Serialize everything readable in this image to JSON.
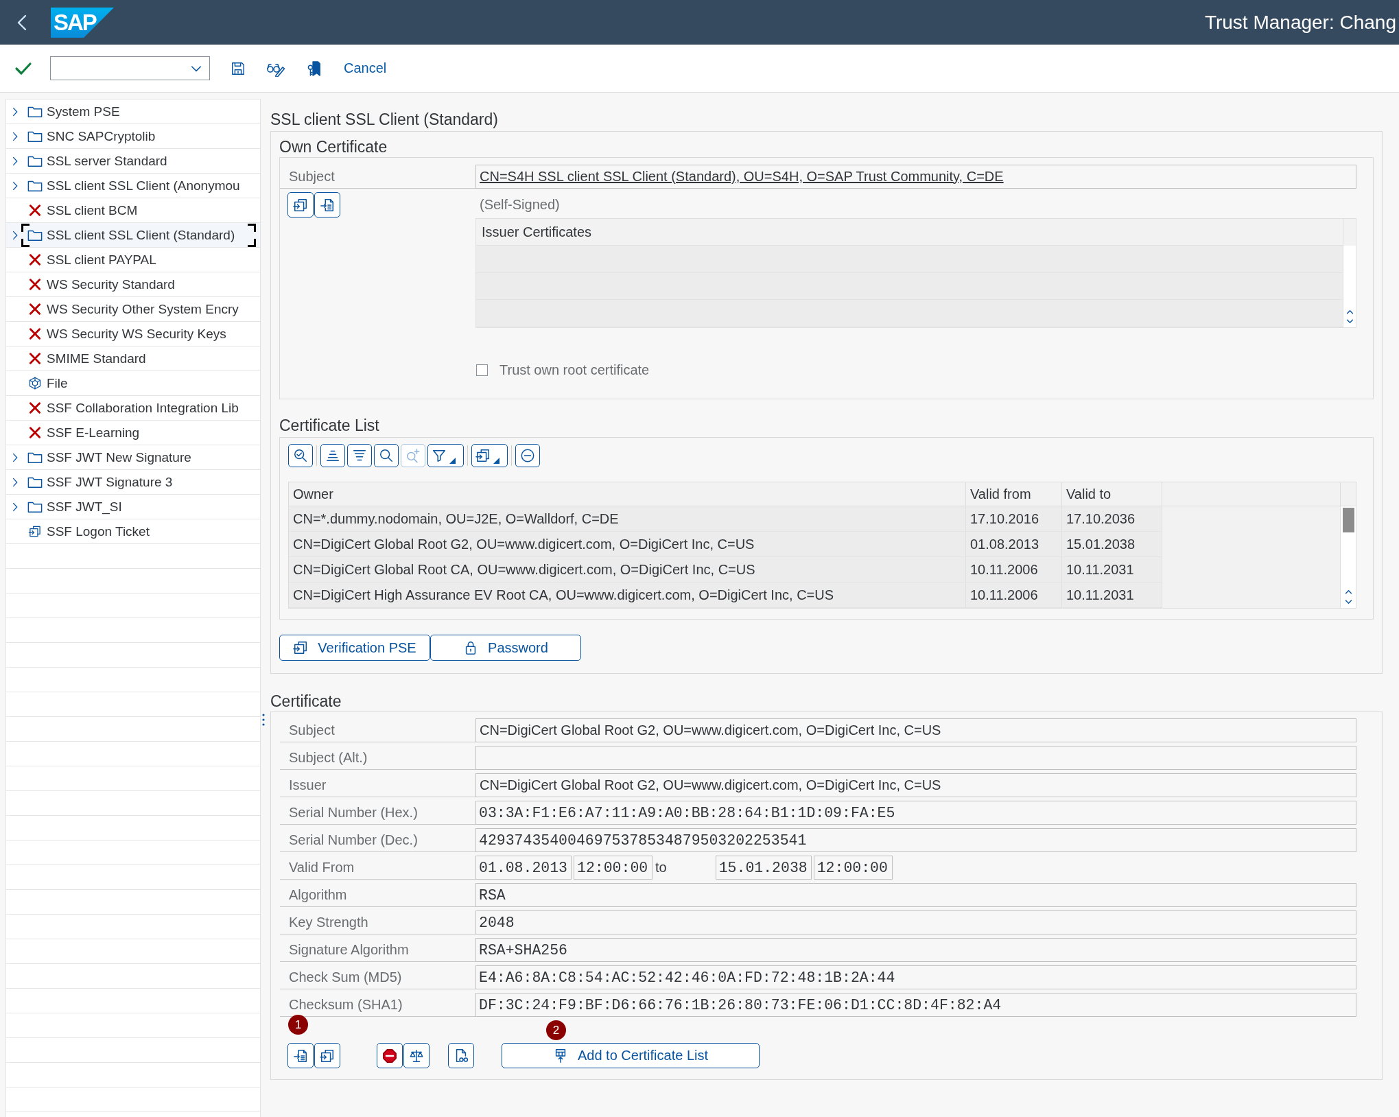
{
  "header": {
    "logo": "SAP",
    "title": "Trust Manager: Chang"
  },
  "toolbar": {
    "cancel": "Cancel"
  },
  "tree": {
    "items": [
      {
        "label": "System PSE",
        "kind": "folder",
        "expanded": false,
        "selected": false
      },
      {
        "label": "SNC SAPCryptolib",
        "kind": "folder",
        "expanded": false,
        "selected": false
      },
      {
        "label": "SSL server Standard",
        "kind": "folder",
        "expanded": false,
        "selected": false
      },
      {
        "label": "SSL client SSL Client (Anonymou",
        "kind": "folder",
        "expanded": false,
        "selected": false
      },
      {
        "label": "SSL client BCM",
        "kind": "error",
        "selected": false
      },
      {
        "label": "SSL client SSL Client (Standard)",
        "kind": "folder",
        "expanded": false,
        "selected": true
      },
      {
        "label": "SSL client PAYPAL",
        "kind": "error",
        "selected": false
      },
      {
        "label": "WS Security Standard",
        "kind": "error",
        "selected": false
      },
      {
        "label": "WS Security Other System Encry",
        "kind": "error",
        "selected": false
      },
      {
        "label": "WS Security WS Security Keys",
        "kind": "error",
        "selected": false
      },
      {
        "label": "SMIME Standard",
        "kind": "error",
        "selected": false
      },
      {
        "label": "File",
        "kind": "file",
        "selected": false
      },
      {
        "label": "SSF Collaboration Integration Lib",
        "kind": "error",
        "selected": false
      },
      {
        "label": "SSF E-Learning",
        "kind": "error",
        "selected": false
      },
      {
        "label": "SSF JWT New Signature",
        "kind": "folder",
        "expanded": false,
        "selected": false
      },
      {
        "label": "SSF JWT Signature 3",
        "kind": "folder",
        "expanded": false,
        "selected": false
      },
      {
        "label": "SSF JWT_SI",
        "kind": "folder",
        "expanded": false,
        "selected": false
      },
      {
        "label": "SSF Logon Ticket",
        "kind": "ticket",
        "selected": false
      }
    ]
  },
  "pse_title": "SSL client SSL Client (Standard)",
  "own_certificate": {
    "title": "Own Certificate",
    "subject_label": "Subject",
    "subject": "CN=S4H SSL client SSL Client (Standard), OU=S4H, O=SAP Trust Community, C=DE",
    "buttons": [
      {
        "kind": "import"
      },
      {
        "kind": "export"
      }
    ],
    "status": "(Self-Signed)",
    "issuer_table": {
      "column": "Issuer Certificates"
    },
    "trust_root": {
      "label": "Trust own root certificate",
      "checked": false
    }
  },
  "certificate_list": {
    "title": "Certificate List",
    "toolbar_groups": [
      {
        "buttons": [
          {
            "kind": "details",
            "disabled": false
          }
        ]
      },
      {
        "buttons": [
          {
            "kind": "sort_asc",
            "disabled": false
          },
          {
            "kind": "sort_desc",
            "disabled": false
          },
          {
            "kind": "find",
            "disabled": false
          },
          {
            "kind": "find_next",
            "disabled": true
          },
          {
            "kind": "filter",
            "disabled": false
          }
        ]
      },
      {
        "buttons": [
          {
            "kind": "export",
            "disabled": false
          }
        ]
      },
      {
        "buttons": [
          {
            "kind": "delete",
            "disabled": false
          }
        ]
      }
    ],
    "columns": [
      "Owner",
      "Valid from",
      "Valid to"
    ],
    "rows": [
      {
        "owner": "CN=*.dummy.nodomain, OU=J2E, O=Walldorf, C=DE",
        "valid_from": "17.10.2016",
        "valid_to": "17.10.2036"
      },
      {
        "owner": "CN=DigiCert Global Root G2, OU=www.digicert.com, O=DigiCert Inc, C=US",
        "valid_from": "01.08.2013",
        "valid_to": "15.01.2038"
      },
      {
        "owner": "CN=DigiCert Global Root CA, OU=www.digicert.com, O=DigiCert Inc, C=US",
        "valid_from": "10.11.2006",
        "valid_to": "10.11.2031"
      },
      {
        "owner": "CN=DigiCert High Assurance EV Root CA, OU=www.digicert.com, O=DigiCert Inc, C=US",
        "valid_from": "10.11.2006",
        "valid_to": "10.11.2031"
      }
    ]
  },
  "pse_buttons": [
    {
      "label": "Verification PSE",
      "kind": "import"
    },
    {
      "label": "Password",
      "kind": "lock"
    }
  ],
  "certificate": {
    "title": "Certificate",
    "fields": [
      {
        "label": "Subject",
        "kind": "text",
        "value": "CN=DigiCert Global Root G2, OU=www.digicert.com, O=DigiCert Inc, C=US"
      },
      {
        "label": "Subject (Alt.)",
        "kind": "text"
      },
      {
        "label": "Issuer",
        "kind": "text",
        "value": "CN=DigiCert Global Root G2, OU=www.digicert.com, O=DigiCert Inc, C=US"
      },
      {
        "label": "Serial Number (Hex.)",
        "kind": "mono",
        "value": "03:3A:F1:E6:A7:11:A9:A0:BB:28:64:B1:1D:09:FA:E5"
      },
      {
        "label": "Serial Number (Dec.)",
        "kind": "mono",
        "value": "4293743540046975378534879503202253541"
      },
      {
        "label": "Valid From",
        "kind": "validity",
        "from_date": "01.08.2013",
        "from_time": "12:00:00",
        "to_label": "to",
        "to_date": "15.01.2038",
        "to_time": "12:00:00"
      },
      {
        "label": "Algorithm",
        "kind": "mono",
        "value": "RSA"
      },
      {
        "label": "Key Strength",
        "kind": "mono",
        "value": "2048"
      },
      {
        "label": "Signature Algorithm",
        "kind": "mono",
        "value": "RSA+SHA256"
      },
      {
        "label": "Check Sum (MD5)",
        "kind": "mono",
        "value": "E4:A6:8A:C8:54:AC:52:42:46:0A:FD:72:48:1B:2A:44"
      },
      {
        "label": "Checksum (SHA1)",
        "kind": "mono",
        "value": "DF:3C:24:F9:BF:D6:66:76:1B:26:80:73:FE:06:D1:CC:8D:4F:82:A4"
      }
    ],
    "actions": {
      "groups": [
        {
          "badge": "1",
          "buttons": [
            {
              "kind": "export"
            },
            {
              "kind": "import"
            }
          ]
        },
        {
          "buttons": [
            {
              "kind": "stop"
            },
            {
              "kind": "compare"
            }
          ]
        },
        {
          "buttons": [
            {
              "kind": "display"
            }
          ]
        }
      ],
      "add": {
        "label": "Add to Certificate List",
        "badge": "2"
      }
    }
  }
}
